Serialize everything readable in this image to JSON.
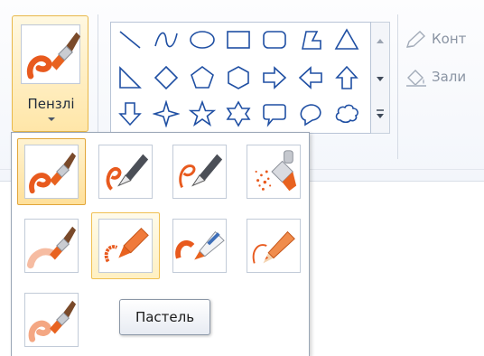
{
  "brushes_button": {
    "label": "Пензлі"
  },
  "tools": {
    "outline": {
      "label": "Конт"
    },
    "fill": {
      "label": "Зали"
    }
  },
  "shapes": [
    "line-shape-icon",
    "curve-shape-icon",
    "oval-shape-icon",
    "rectangle-shape-icon",
    "rounded-rectangle-shape-icon",
    "polygon-shape-icon",
    "triangle-shape-icon",
    "right-triangle-shape-icon",
    "diamond-shape-icon",
    "pentagon-shape-icon",
    "hexagon-shape-icon",
    "right-arrow-shape-icon",
    "left-arrow-shape-icon",
    "up-arrow-shape-icon",
    "down-arrow-shape-icon",
    "four-point-star-shape-icon",
    "five-point-star-shape-icon",
    "six-point-star-shape-icon",
    "rounded-callout-shape-icon",
    "oval-callout-shape-icon",
    "cloud-callout-shape-icon"
  ],
  "brushes": [
    {
      "id": "brush",
      "icon": "brush-icon",
      "state": "selected"
    },
    {
      "id": "calligraphy-brush-1",
      "icon": "calligraphy-pen-icon",
      "state": "normal"
    },
    {
      "id": "calligraphy-brush-2",
      "icon": "calligraphy-pen-2-icon",
      "state": "normal"
    },
    {
      "id": "airbrush",
      "icon": "airbrush-icon",
      "state": "normal"
    },
    {
      "id": "oil-brush",
      "icon": "oil-brush-icon",
      "state": "normal"
    },
    {
      "id": "crayon",
      "icon": "crayon-icon",
      "state": "hover"
    },
    {
      "id": "marker",
      "icon": "marker-icon",
      "state": "normal"
    },
    {
      "id": "natural-pencil",
      "icon": "pencil-icon",
      "state": "normal"
    },
    {
      "id": "watercolor-brush",
      "icon": "watercolor-brush-icon",
      "state": "normal"
    }
  ],
  "tooltip": {
    "text": "Пастель"
  },
  "colors": {
    "accent": "#e2a63a",
    "stroke": "#e85a1e",
    "shape_stroke": "#1f4fa3"
  }
}
